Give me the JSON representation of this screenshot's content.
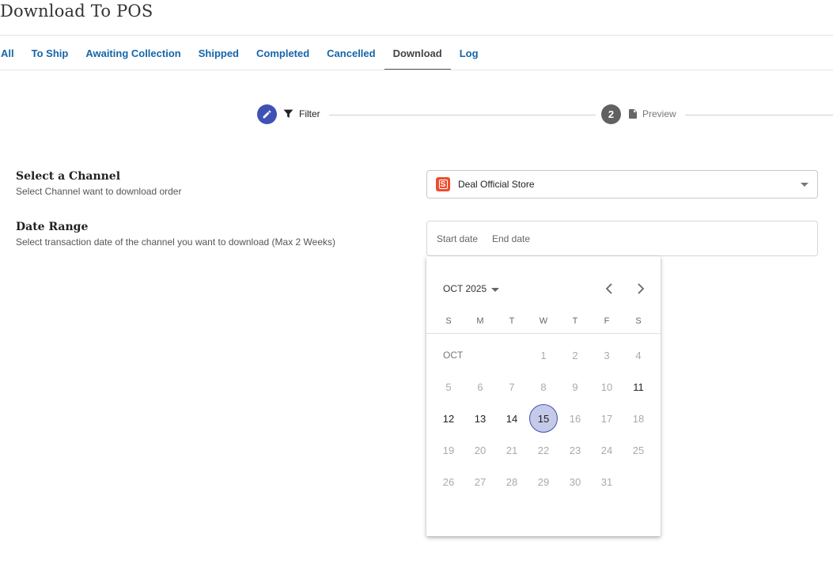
{
  "page": {
    "title": "Download To POS"
  },
  "tabs": [
    {
      "label": "All",
      "active": false
    },
    {
      "label": "To Ship",
      "active": false
    },
    {
      "label": "Awaiting Collection",
      "active": false
    },
    {
      "label": "Shipped",
      "active": false
    },
    {
      "label": "Completed",
      "active": false
    },
    {
      "label": "Cancelled",
      "active": false
    },
    {
      "label": "Download",
      "active": true
    },
    {
      "label": "Log",
      "active": false
    }
  ],
  "stepper": {
    "step1": {
      "icon": "pencil-icon",
      "label": "Filter",
      "label_icon": "filter-icon",
      "color": "#3f51b5"
    },
    "step2": {
      "number": "2",
      "label": "Preview",
      "label_icon": "document-icon",
      "color": "#616161"
    }
  },
  "channel": {
    "title": "Select a Channel",
    "subtitle": "Select Channel want to download order",
    "selected": "Deal Official Store",
    "store_icon": "shopee-bag-icon",
    "brand_color": "#ee4d2d"
  },
  "date_range": {
    "title": "Date Range",
    "subtitle": "Select transaction date of the channel you want to download (Max 2 Weeks)",
    "start_placeholder": "Start date",
    "end_placeholder": "End date"
  },
  "calendar": {
    "month_label": "OCT 2025",
    "month_tag": "OCT",
    "weekdays": [
      "S",
      "M",
      "T",
      "W",
      "T",
      "F",
      "S"
    ],
    "first_weekday": 3,
    "days_in_month": 31,
    "enabled_days": [
      11,
      12,
      13,
      14,
      15
    ],
    "selected_day": 15,
    "accent": "#3f51b5",
    "selected_fill": "#c5cae9"
  }
}
